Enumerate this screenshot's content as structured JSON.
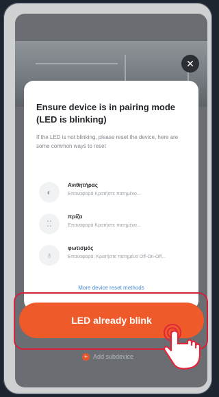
{
  "modal": {
    "title": "Ensure device is in pairing mode (LED is blinking)",
    "description": "If the LED is not blinking, please reset the device, here are some common ways to reset",
    "methods": [
      {
        "name": "Ανιθητήρας",
        "desc": "Επαναφορά Κρατήστε πατημένο..."
      },
      {
        "name": "πρίζα",
        "desc": "Επαναφορά Κρατήστε πατημένο..."
      },
      {
        "name": "φωτισμός",
        "desc": "Επαναφορά: Κρατήστε πατημένο Off-On-Off..."
      }
    ],
    "more_link": "More device reset methods"
  },
  "primary_button": {
    "label": "LED already blink"
  },
  "secondary": {
    "label": "Add subdevice"
  },
  "icons": {
    "close": "close-icon",
    "hand": "pointing-hand-icon",
    "plus": "plus-icon"
  },
  "colors": {
    "accent": "#ee5a2a",
    "highlight_border": "#d3223a",
    "link": "#4a8bd1"
  }
}
